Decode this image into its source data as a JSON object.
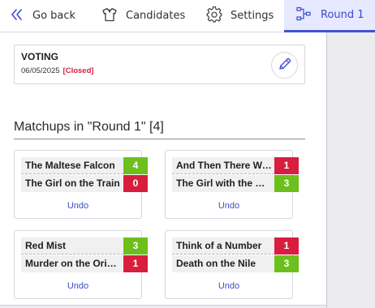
{
  "nav": {
    "back_label": "Go back",
    "candidates_label": "Candidates",
    "settings_label": "Settings",
    "round_label": "Round 1",
    "accent_color": "#4253d1"
  },
  "voting": {
    "title": "VOTING",
    "date": "06/05/2025",
    "status": "[Closed]"
  },
  "section": {
    "title": "Matchups in \"Round 1\" [4]"
  },
  "matchups": [
    {
      "a": {
        "name": "The Maltese Falcon",
        "score": "4"
      },
      "b": {
        "name": "The Girl on the Train",
        "score": "0"
      },
      "undo_label": "Undo"
    },
    {
      "a": {
        "name": "And Then There Were None",
        "score": "1"
      },
      "b": {
        "name": "The Girl with the Dragon Tattoo",
        "score": "3"
      },
      "undo_label": "Undo"
    },
    {
      "a": {
        "name": "Red Mist",
        "score": "3"
      },
      "b": {
        "name": "Murder on the Orient Express",
        "score": "1"
      },
      "undo_label": "Undo"
    },
    {
      "a": {
        "name": "Think of a Number",
        "score": "1"
      },
      "b": {
        "name": "Death on the Nile",
        "score": "3"
      },
      "undo_label": "Undo"
    }
  ],
  "colors": {
    "win": "#6dbf1c",
    "lose": "#d81e3f"
  }
}
